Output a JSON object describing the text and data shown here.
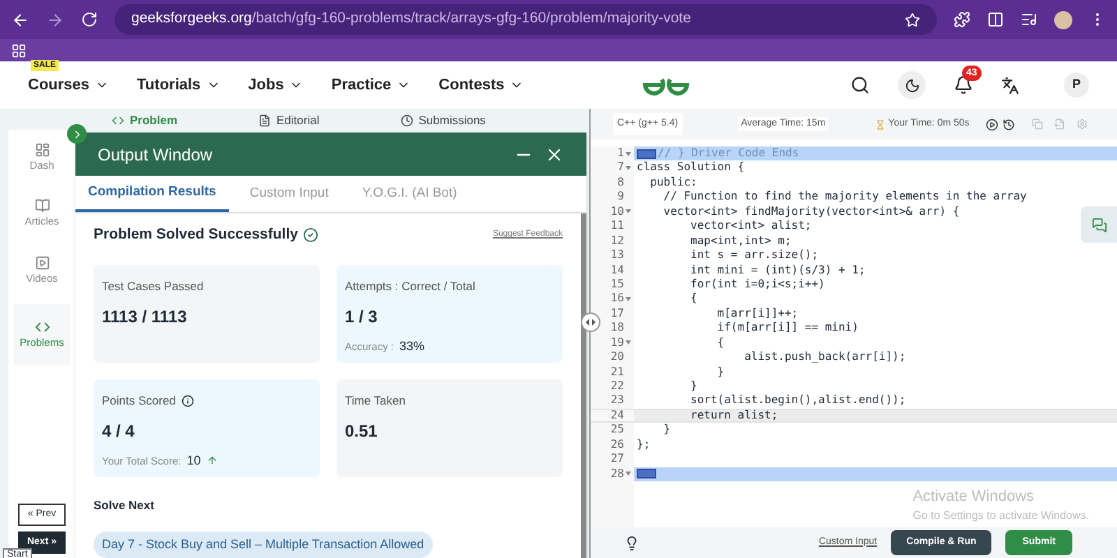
{
  "browser": {
    "url_host": "geeksforgeeks.org",
    "url_path": "/batch/gfg-160-problems/track/arrays-gfg-160/problem/majority-vote"
  },
  "nav": {
    "sale_badge": "SALE",
    "items": [
      "Courses",
      "Tutorials",
      "Jobs",
      "Practice",
      "Contests"
    ],
    "notifications": "43",
    "avatar": "P"
  },
  "sidebar": {
    "items": [
      {
        "label": "Dash",
        "selected": false
      },
      {
        "label": "Articles",
        "selected": false
      },
      {
        "label": "Videos",
        "selected": false
      },
      {
        "label": "Problems",
        "selected": true
      }
    ],
    "prev": "« Prev",
    "next": "Next »",
    "start": "Start"
  },
  "problem_tabs": [
    {
      "label": "Problem",
      "selected": true
    },
    {
      "label": "Editorial",
      "selected": false
    },
    {
      "label": "Submissions",
      "selected": false
    }
  ],
  "output_window": {
    "title": "Output Window",
    "tabs": [
      {
        "label": "Compilation Results",
        "selected": true
      },
      {
        "label": "Custom Input",
        "selected": false
      },
      {
        "label": "Y.O.G.I. (AI Bot)",
        "selected": false
      }
    ],
    "status": "Problem Solved Successfully",
    "feedback_link": "Suggest Feedback",
    "cards": [
      {
        "title": "Test Cases Passed",
        "value": "1113 / 1113"
      },
      {
        "title": "Attempts : Correct / Total",
        "value": "1 / 3",
        "note_label": "Accuracy :",
        "note_value": "33%"
      },
      {
        "title": "Points Scored",
        "value": "4 / 4",
        "note_label": "Your Total Score:",
        "note_value": "10",
        "info": true,
        "trend_up": true
      },
      {
        "title": "Time Taken",
        "value": "0.51"
      }
    ],
    "solve_next_heading": "Solve Next",
    "solve_next": [
      "Day 7 - Stock Buy and Sell – Multiple Transaction Allowed"
    ]
  },
  "editor": {
    "language": "C++ (g++ 5.4)",
    "average_time": "Average Time: 15m",
    "your_time": "Your Time: 0m 50s",
    "lines": [
      {
        "n": "1",
        "foldable": true,
        "folded": true,
        "selected": true,
        "current": false,
        "code": "// } Driver Code Ends"
      },
      {
        "n": "7",
        "foldable": true,
        "folded": false,
        "selected": false,
        "current": false,
        "code": "class Solution {"
      },
      {
        "n": "8",
        "foldable": false,
        "folded": false,
        "selected": false,
        "current": false,
        "code": "  public:"
      },
      {
        "n": "9",
        "foldable": false,
        "folded": false,
        "selected": false,
        "current": false,
        "code": "    // Function to find the majority elements in the array"
      },
      {
        "n": "10",
        "foldable": true,
        "folded": false,
        "selected": false,
        "current": false,
        "code": "    vector<int> findMajority(vector<int>& arr) {"
      },
      {
        "n": "11",
        "foldable": false,
        "folded": false,
        "selected": false,
        "current": false,
        "code": "        vector<int> alist;"
      },
      {
        "n": "12",
        "foldable": false,
        "folded": false,
        "selected": false,
        "current": false,
        "code": "        map<int,int> m;"
      },
      {
        "n": "13",
        "foldable": false,
        "folded": false,
        "selected": false,
        "current": false,
        "code": "        int s = arr.size();"
      },
      {
        "n": "14",
        "foldable": false,
        "folded": false,
        "selected": false,
        "current": false,
        "code": "        int mini = (int)(s/3) + 1;"
      },
      {
        "n": "15",
        "foldable": false,
        "folded": false,
        "selected": false,
        "current": false,
        "code": "        for(int i=0;i<s;i++)"
      },
      {
        "n": "16",
        "foldable": true,
        "folded": false,
        "selected": false,
        "current": false,
        "code": "        {"
      },
      {
        "n": "17",
        "foldable": false,
        "folded": false,
        "selected": false,
        "current": false,
        "code": "            m[arr[i]]++;"
      },
      {
        "n": "18",
        "foldable": false,
        "folded": false,
        "selected": false,
        "current": false,
        "code": "            if(m[arr[i]] == mini)"
      },
      {
        "n": "19",
        "foldable": true,
        "folded": false,
        "selected": false,
        "current": false,
        "code": "            {"
      },
      {
        "n": "20",
        "foldable": false,
        "folded": false,
        "selected": false,
        "current": false,
        "code": "                alist.push_back(arr[i]);"
      },
      {
        "n": "21",
        "foldable": false,
        "folded": false,
        "selected": false,
        "current": false,
        "code": "            }"
      },
      {
        "n": "22",
        "foldable": false,
        "folded": false,
        "selected": false,
        "current": false,
        "code": "        }"
      },
      {
        "n": "23",
        "foldable": false,
        "folded": false,
        "selected": false,
        "current": false,
        "code": "        sort(alist.begin(),alist.end());"
      },
      {
        "n": "24",
        "foldable": false,
        "folded": false,
        "selected": false,
        "current": true,
        "code": "        return alist;"
      },
      {
        "n": "25",
        "foldable": false,
        "folded": false,
        "selected": false,
        "current": false,
        "code": "    }"
      },
      {
        "n": "26",
        "foldable": false,
        "folded": false,
        "selected": false,
        "current": false,
        "code": "};"
      },
      {
        "n": "27",
        "foldable": false,
        "folded": false,
        "selected": false,
        "current": false
      },
      {
        "n": "28",
        "foldable": true,
        "folded": true,
        "selected": true,
        "current": false
      }
    ],
    "os_notice": [
      "Activate Windows",
      "Go to Settings to activate Windows."
    ],
    "custom_input": "Custom Input",
    "compile": "Compile & Run",
    "submit": "Submit"
  }
}
